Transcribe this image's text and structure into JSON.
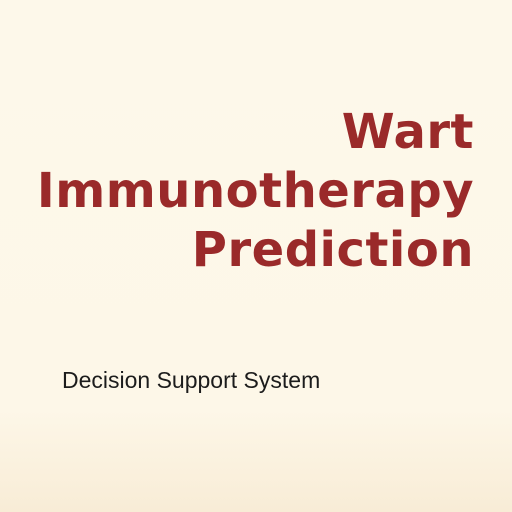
{
  "splash": {
    "title_lines": [
      "Wart",
      "Immunotherapy",
      "Prediction"
    ],
    "subtitle": "Decision Support System"
  },
  "colors": {
    "background": "#fdf8ea",
    "title": "#9a2a2a",
    "subtitle": "#1c1c1c"
  }
}
